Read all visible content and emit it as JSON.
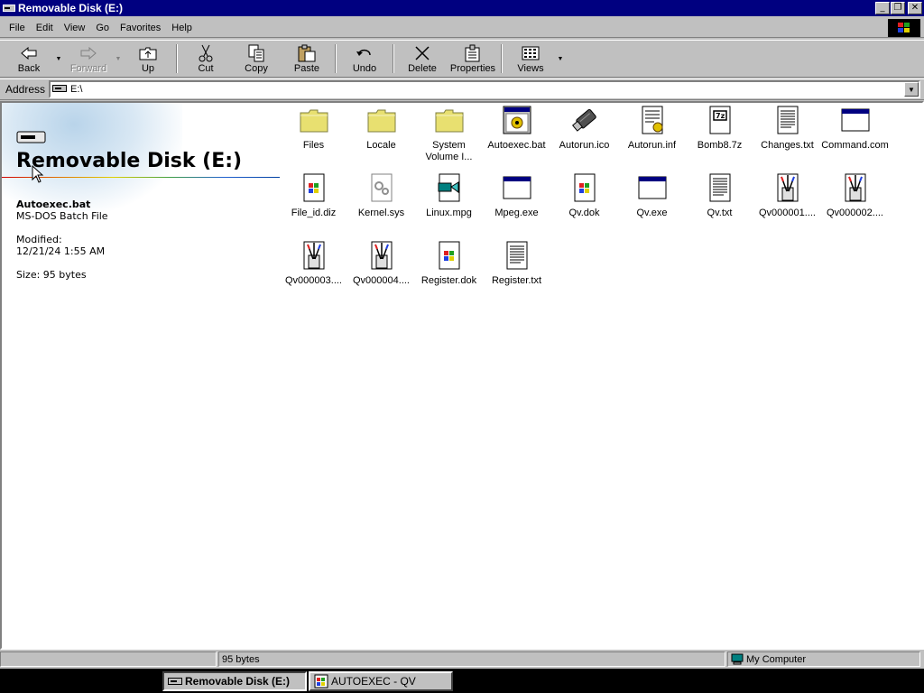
{
  "window": {
    "title": "Removable Disk (E:)",
    "controls": {
      "minimize": "_",
      "maximize": "❐",
      "close": "✕"
    }
  },
  "menu": [
    "File",
    "Edit",
    "View",
    "Go",
    "Favorites",
    "Help"
  ],
  "toolbar": {
    "back": "Back",
    "forward": "Forward",
    "up": "Up",
    "cut": "Cut",
    "copy": "Copy",
    "paste": "Paste",
    "undo": "Undo",
    "delete": "Delete",
    "properties": "Properties",
    "views": "Views"
  },
  "address": {
    "label": "Address",
    "value": "E:\\"
  },
  "leftpane": {
    "title": "Removable Disk (E:)",
    "file_name": "Autoexec.bat",
    "file_type": "MS-DOS Batch File",
    "modified_label": "Modified:",
    "modified_value": "12/21/24 1:55 AM",
    "size": "Size: 95 bytes"
  },
  "files": [
    {
      "name": "Files",
      "icon": "folder-icon"
    },
    {
      "name": "Locale",
      "icon": "folder-icon"
    },
    {
      "name": "System Volume I...",
      "icon": "folder-icon"
    },
    {
      "name": "Autoexec.bat",
      "icon": "batch-file-icon"
    },
    {
      "name": "Autorun.ico",
      "icon": "usb-drive-icon"
    },
    {
      "name": "Autorun.inf",
      "icon": "setup-info-icon"
    },
    {
      "name": "Bomb8.7z",
      "icon": "archive-7z-icon"
    },
    {
      "name": "Changes.txt",
      "icon": "text-file-icon"
    },
    {
      "name": "Command.com",
      "icon": "application-window-icon"
    },
    {
      "name": "File_id.diz",
      "icon": "windows-doc-icon"
    },
    {
      "name": "Kernel.sys",
      "icon": "system-file-icon"
    },
    {
      "name": "Linux.mpg",
      "icon": "video-file-icon"
    },
    {
      "name": "Mpeg.exe",
      "icon": "application-window-icon"
    },
    {
      "name": "Qv.dok",
      "icon": "windows-doc-icon"
    },
    {
      "name": "Qv.exe",
      "icon": "application-window-icon"
    },
    {
      "name": "Qv.txt",
      "icon": "text-file-icon"
    },
    {
      "name": "Qv000001....",
      "icon": "tools-file-icon"
    },
    {
      "name": "Qv000002....",
      "icon": "tools-file-icon"
    },
    {
      "name": "Qv000003....",
      "icon": "tools-file-icon"
    },
    {
      "name": "Qv000004....",
      "icon": "tools-file-icon"
    },
    {
      "name": "Register.dok",
      "icon": "windows-doc-icon"
    },
    {
      "name": "Register.txt",
      "icon": "text-file-icon"
    }
  ],
  "status": {
    "size": "95 bytes",
    "zone": "My Computer"
  },
  "taskbar": [
    {
      "label": "Removable Disk (E:)",
      "active": true
    },
    {
      "label": "AUTOEXEC - QV",
      "active": false
    }
  ]
}
